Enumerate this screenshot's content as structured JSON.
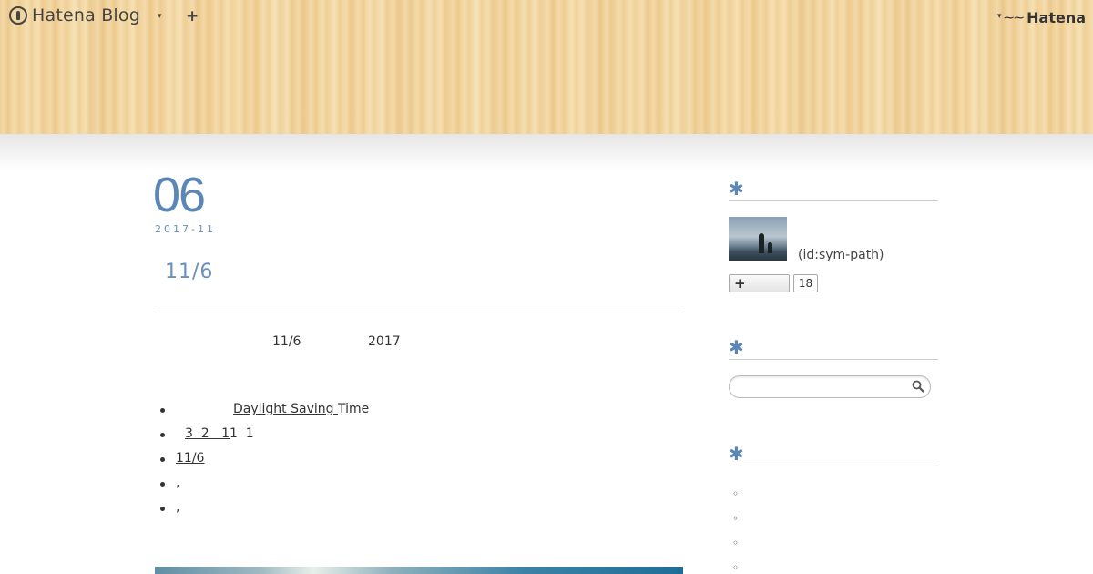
{
  "header": {
    "logo_text": "Hatena Blog",
    "caret_left": "▾",
    "plus": "+",
    "caret_right": "▾",
    "brand_mini": "⁓⁓",
    "brand": "Hatena"
  },
  "entry": {
    "day": "06",
    "year_month": "2017-11",
    "title": "11/6",
    "intro_a": "11/6",
    "intro_b": "2017",
    "list": [
      {
        "link": "Daylight Saving ",
        "rest": "Time"
      },
      {
        "link": "3  2   1",
        "rest": "1  1"
      },
      {
        "link": "11/6",
        "rest": ""
      },
      {
        "link": "",
        "rest": ","
      },
      {
        "link": "",
        "rest": ","
      }
    ]
  },
  "sidebar": {
    "star": "✱",
    "user_id": "(id:sym-path)",
    "subscribe_label": "+",
    "subscribe_count": "18",
    "circle_items": [
      "◦",
      "◦",
      "◦",
      "◦"
    ]
  },
  "colors": {
    "accent": "#5c86b5",
    "wood": "#f3d9a4"
  }
}
